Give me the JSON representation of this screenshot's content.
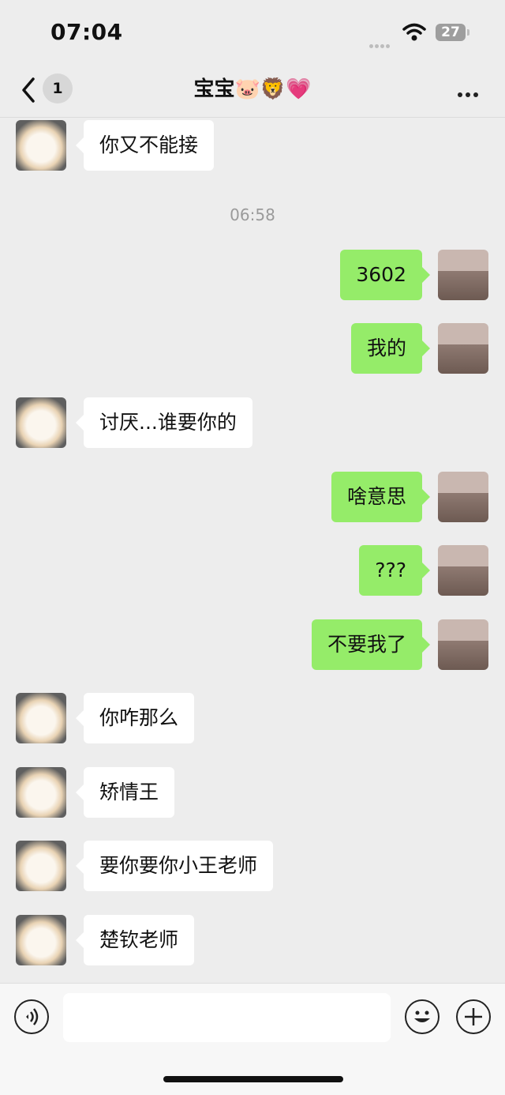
{
  "status_bar": {
    "time": "07:04",
    "battery": "27"
  },
  "nav": {
    "unread_count": "1",
    "title": "宝宝🐷🦁💗"
  },
  "messages": [
    {
      "side": "in",
      "text": "你又不能接"
    },
    {
      "side": "out",
      "text": "3602"
    },
    {
      "side": "out",
      "text": "我的"
    },
    {
      "side": "in",
      "text": "讨厌...谁要你的"
    },
    {
      "side": "out",
      "text": "啥意思"
    },
    {
      "side": "out",
      "text": "???"
    },
    {
      "side": "out",
      "text": "不要我了"
    },
    {
      "side": "in",
      "text": "你咋那么"
    },
    {
      "side": "in",
      "text": "矫情王"
    },
    {
      "side": "in",
      "text": "要你要你小王老师"
    },
    {
      "side": "in",
      "text": "楚钦老师"
    }
  ],
  "timestamp": "06:58",
  "colors": {
    "outgoing_bubble": "#95ec69",
    "incoming_bubble": "#ffffff",
    "background": "#ededed"
  },
  "icons": [
    "back-icon",
    "wifi-icon",
    "battery-icon",
    "more-icon",
    "voice-icon",
    "emoji-icon",
    "plus-icon"
  ]
}
